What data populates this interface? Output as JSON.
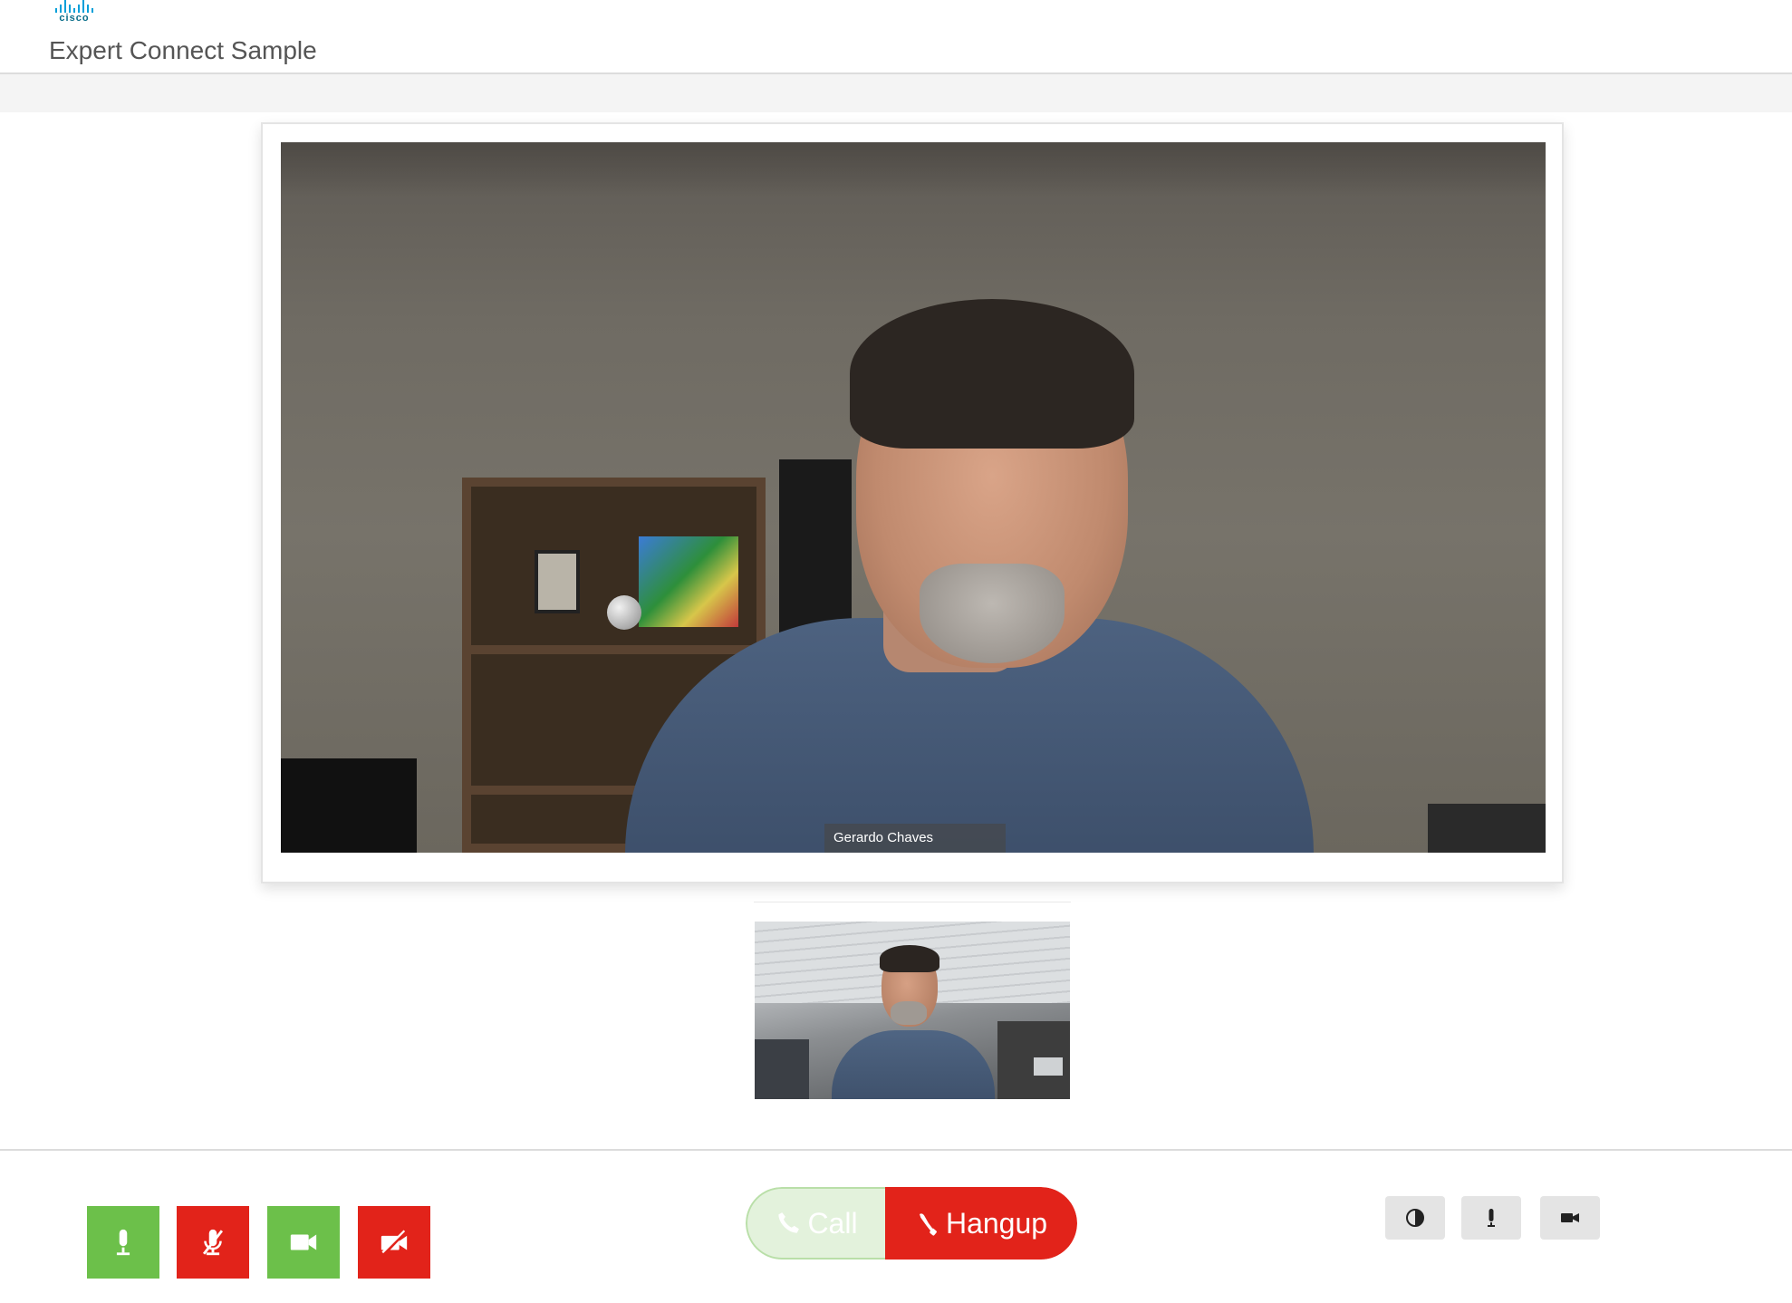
{
  "header": {
    "logo_text": "cisco",
    "title": "Expert Connect Sample"
  },
  "remote_video": {
    "participant_name": "Gerardo Chaves"
  },
  "controls": {
    "left_buttons": [
      {
        "name": "unmute-audio",
        "icon": "microphone-icon",
        "color": "#6cc04a"
      },
      {
        "name": "mute-audio",
        "icon": "microphone-muted-icon",
        "color": "#e2231a"
      },
      {
        "name": "start-video",
        "icon": "video-camera-icon",
        "color": "#6cc04a"
      },
      {
        "name": "stop-video",
        "icon": "video-camera-off-icon",
        "color": "#e2231a"
      }
    ],
    "call_label": "Call",
    "hangup_label": "Hangup",
    "right_buttons": [
      {
        "name": "theme-toggle",
        "icon": "contrast-icon"
      },
      {
        "name": "audio-settings",
        "icon": "microphone-icon"
      },
      {
        "name": "video-settings",
        "icon": "video-camera-icon"
      }
    ]
  },
  "colors": {
    "green": "#6cc04a",
    "red": "#e2231a",
    "call_disabled_bg": "#e3f2dc",
    "util_bg": "#e4e4e4"
  }
}
